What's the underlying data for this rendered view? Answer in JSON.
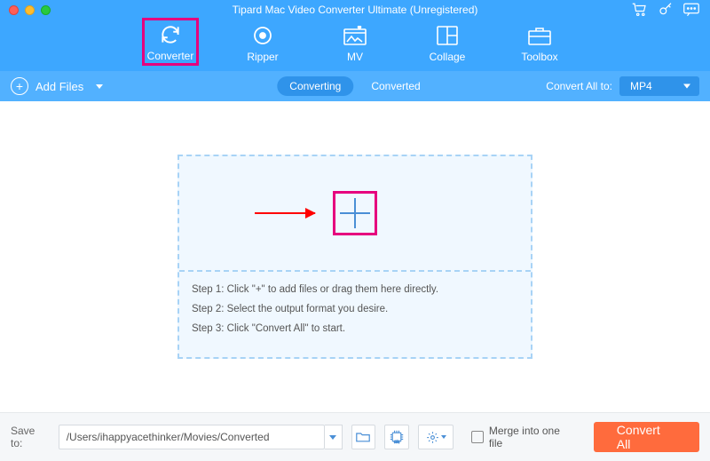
{
  "app": {
    "title": "Tipard Mac Video Converter Ultimate (Unregistered)"
  },
  "nav": {
    "converter": "Converter",
    "ripper": "Ripper",
    "mv": "MV",
    "collage": "Collage",
    "toolbox": "Toolbox"
  },
  "subbar": {
    "addFiles": "Add Files",
    "tabConverting": "Converting",
    "tabConverted": "Converted",
    "convertAllTo": "Convert All to:",
    "format": "MP4"
  },
  "dropInstructions": {
    "step1": "Step 1: Click \"+\" to add files or drag them here directly.",
    "step2": "Step 2: Select the output format you desire.",
    "step3": "Step 3: Click \"Convert All\" to start."
  },
  "footer": {
    "saveTo": "Save to:",
    "path": "/Users/ihappyacethinker/Movies/Converted",
    "merge": "Merge into one file",
    "convertAll": "Convert All"
  }
}
